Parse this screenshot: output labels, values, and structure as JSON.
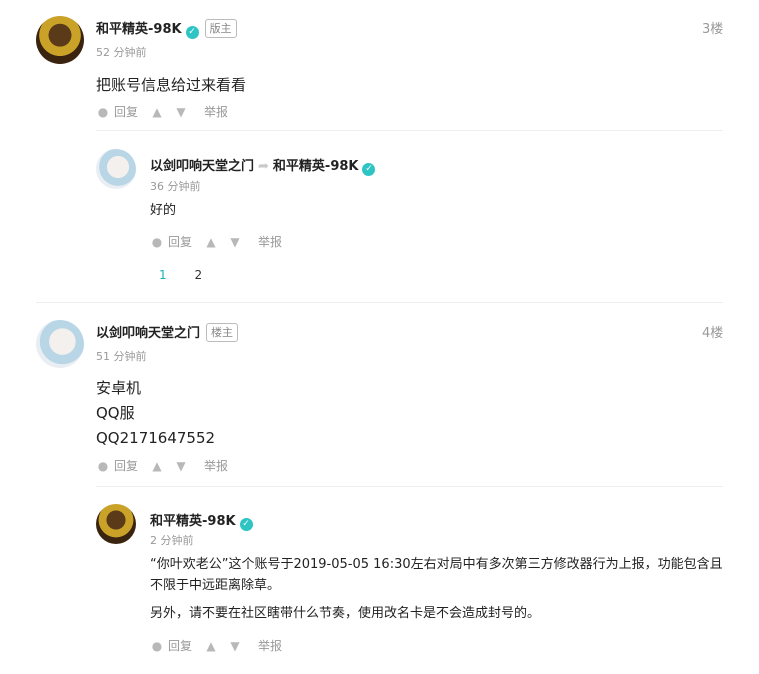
{
  "comments": [
    {
      "author": "和平精英-98K",
      "badge": "版主",
      "time": "52 分钟前",
      "floor": "3楼",
      "text": "把账号信息给过来看看",
      "reply_label": "回复",
      "report_label": "举报",
      "replies": [
        {
          "author": "以剑叩响天堂之门",
          "reply_to": "和平精英-98K",
          "time": "36 分钟前",
          "text": "好的",
          "reply_label": "回复",
          "report_label": "举报"
        }
      ],
      "pages": [
        "1",
        "2"
      ]
    },
    {
      "author": "以剑叩响天堂之门",
      "badge": "楼主",
      "time": "51 分钟前",
      "floor": "4楼",
      "lines": [
        "安卓机",
        "QQ服",
        "QQ2171647552"
      ],
      "reply_label": "回复",
      "report_label": "举报",
      "replies": [
        {
          "author": "和平精英-98K",
          "time": "2 分钟前",
          "para1": "“你叶欢老公”这个账号于2019-05-05 16:30左右对局中有多次第三方修改器行为上报，功能包含且不限于中远距离除草。",
          "para2": "另外，请不要在社区瞎带什么节奏，使用改名卡是不会造成封号的。",
          "reply_label": "回复",
          "report_label": "举报"
        }
      ]
    }
  ]
}
